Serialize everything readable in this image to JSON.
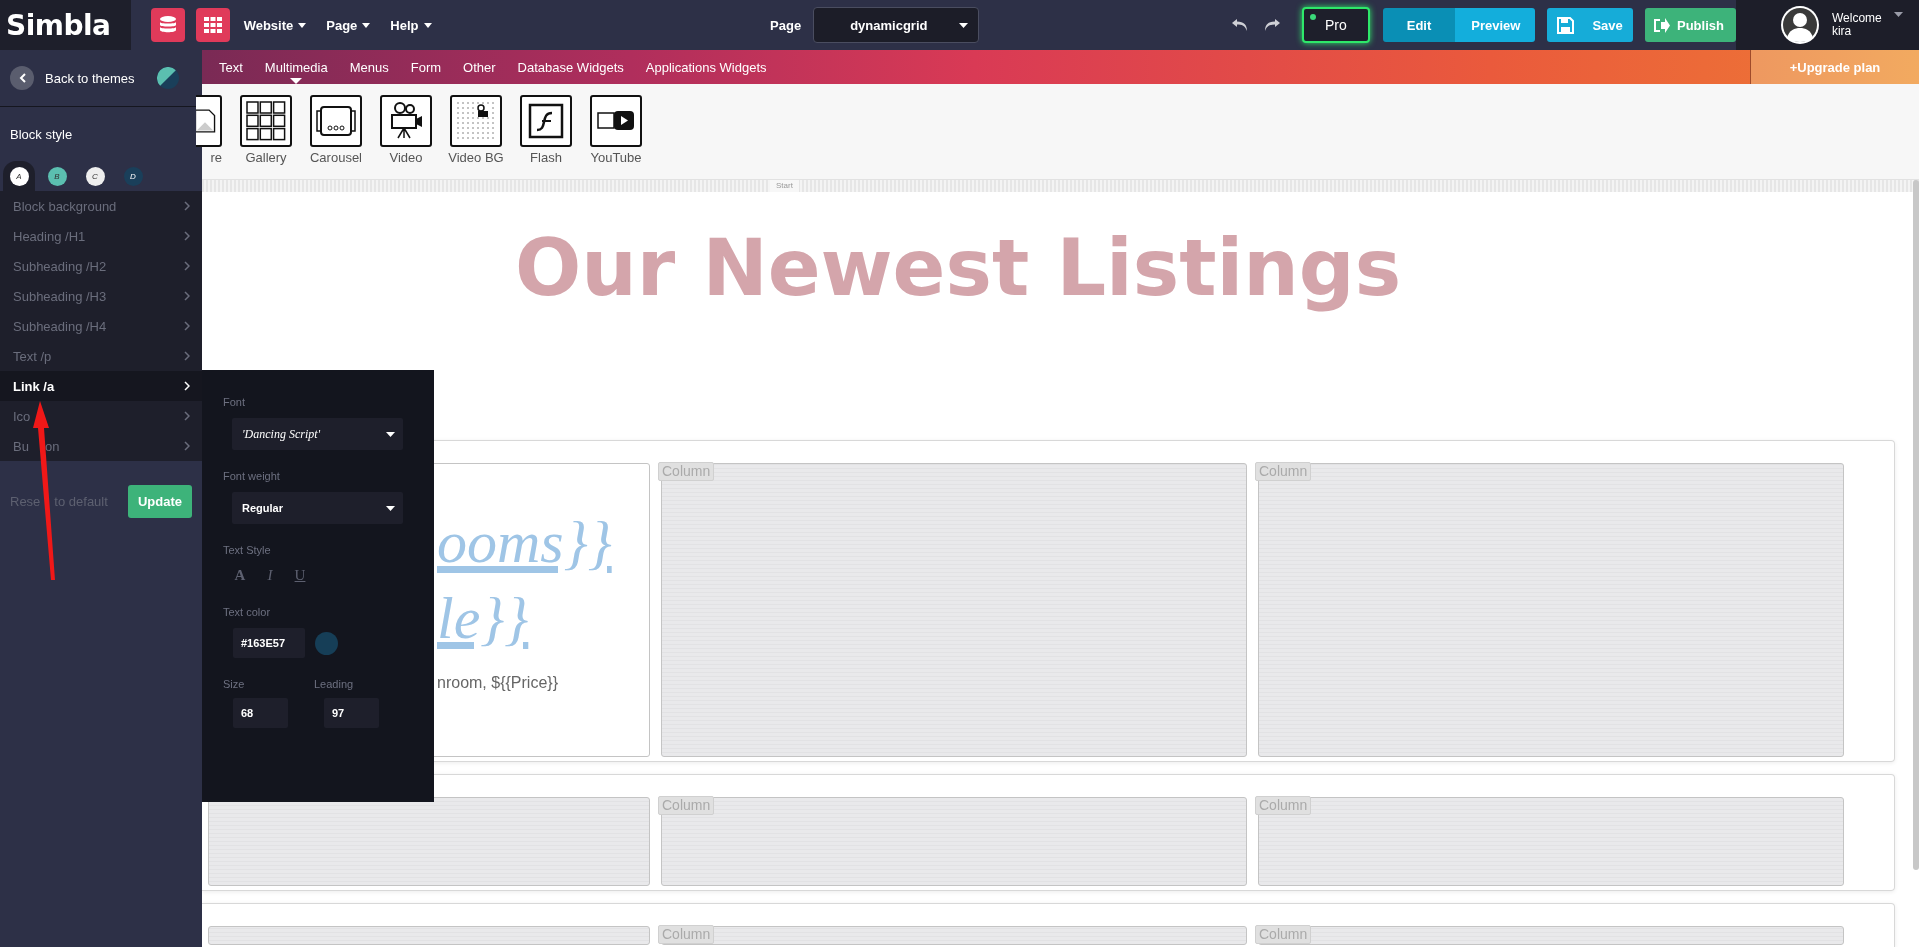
{
  "top_bar": {
    "logo": "Simbla",
    "menus": [
      {
        "label": "Website"
      },
      {
        "label": "Page"
      },
      {
        "label": "Help"
      }
    ],
    "page_label": "Page",
    "page_select": "dynamicgrid",
    "pro": {
      "label": "Pro",
      "on": true
    },
    "mode_buttons": [
      {
        "label": "Edit",
        "selected": true
      },
      {
        "label": "Preview",
        "selected": false
      }
    ],
    "save": "Save",
    "publish": "Publish",
    "user": {
      "greeting": "Welcome",
      "name": "kira"
    }
  },
  "categories": [
    {
      "label": "Text",
      "selected": false
    },
    {
      "label": "Multimedia",
      "selected": true
    },
    {
      "label": "Menus",
      "selected": false
    },
    {
      "label": "Form",
      "selected": false
    },
    {
      "label": "Other",
      "selected": false
    },
    {
      "label": "Database Widgets",
      "selected": false
    },
    {
      "label": "Applications Widgets",
      "selected": false
    }
  ],
  "upgrade": "+Upgrade plan",
  "widgets": [
    {
      "kind": "image",
      "label": "re"
    },
    {
      "kind": "gallery",
      "label": "Gallery"
    },
    {
      "kind": "carousel",
      "label": "Carousel"
    },
    {
      "kind": "video",
      "label": "Video"
    },
    {
      "kind": "videobg",
      "label": "Video BG"
    },
    {
      "kind": "flash",
      "label": "Flash"
    },
    {
      "kind": "youtube",
      "label": "YouTube"
    }
  ],
  "sidebar": {
    "back": "Back to themes",
    "section": "Block style",
    "swatches": [
      {
        "letter": "A",
        "color": "#ffffff",
        "selected": true
      },
      {
        "letter": "B",
        "color": "#5bbfb0",
        "selected": false
      },
      {
        "letter": "C",
        "color": "#eeeeee",
        "selected": false
      },
      {
        "letter": "D",
        "color": "#1a3f5a",
        "selected": false
      }
    ],
    "items": [
      {
        "label": "Block background",
        "selected": false
      },
      {
        "label": "Heading /H1",
        "selected": false
      },
      {
        "label": "Subheading /H2",
        "selected": false
      },
      {
        "label": "Subheading /H3",
        "selected": false
      },
      {
        "label": "Subheading /H4",
        "selected": false
      },
      {
        "label": "Text /p",
        "selected": false
      },
      {
        "label": "Link /a",
        "selected": true
      },
      {
        "label": "Ico",
        "selected": false
      },
      {
        "label": "Bu",
        "label_tail": "on",
        "selected": false
      }
    ],
    "reset": "Rese",
    "reset_tail": "to default",
    "update": "Update"
  },
  "style_panel": {
    "font_label": "Font",
    "font": "'Dancing Script'",
    "weight_label": "Font weight",
    "weight": "Regular",
    "style_label": "Text Style",
    "styles": [
      {
        "kind": "bold",
        "label": "A"
      },
      {
        "kind": "italic",
        "label": "I"
      },
      {
        "kind": "underline",
        "label": "U"
      }
    ],
    "color_label": "Text color",
    "color_value": "#163E57",
    "size_label": "Size",
    "size": "68",
    "leading_label": "Leading",
    "leading": "97"
  },
  "canvas": {
    "start_marker": "Start",
    "title": "Our Newest Listings",
    "rows": [
      {
        "columns": [
          {
            "kind": "content",
            "link_lines": [
              "ooms}}",
              "le}}"
            ],
            "text": "nroom, ${{Price}}"
          },
          {
            "kind": "empty",
            "tag": "Column"
          },
          {
            "kind": "empty",
            "tag": "Column"
          }
        ]
      },
      {
        "columns": [
          {
            "kind": "empty"
          },
          {
            "kind": "empty",
            "tag": "Column"
          },
          {
            "kind": "empty",
            "tag": "Column"
          }
        ]
      },
      {
        "columns": [
          {
            "kind": "empty"
          },
          {
            "kind": "empty",
            "tag": "Column"
          },
          {
            "kind": "empty",
            "tag": "Column"
          }
        ]
      }
    ]
  }
}
